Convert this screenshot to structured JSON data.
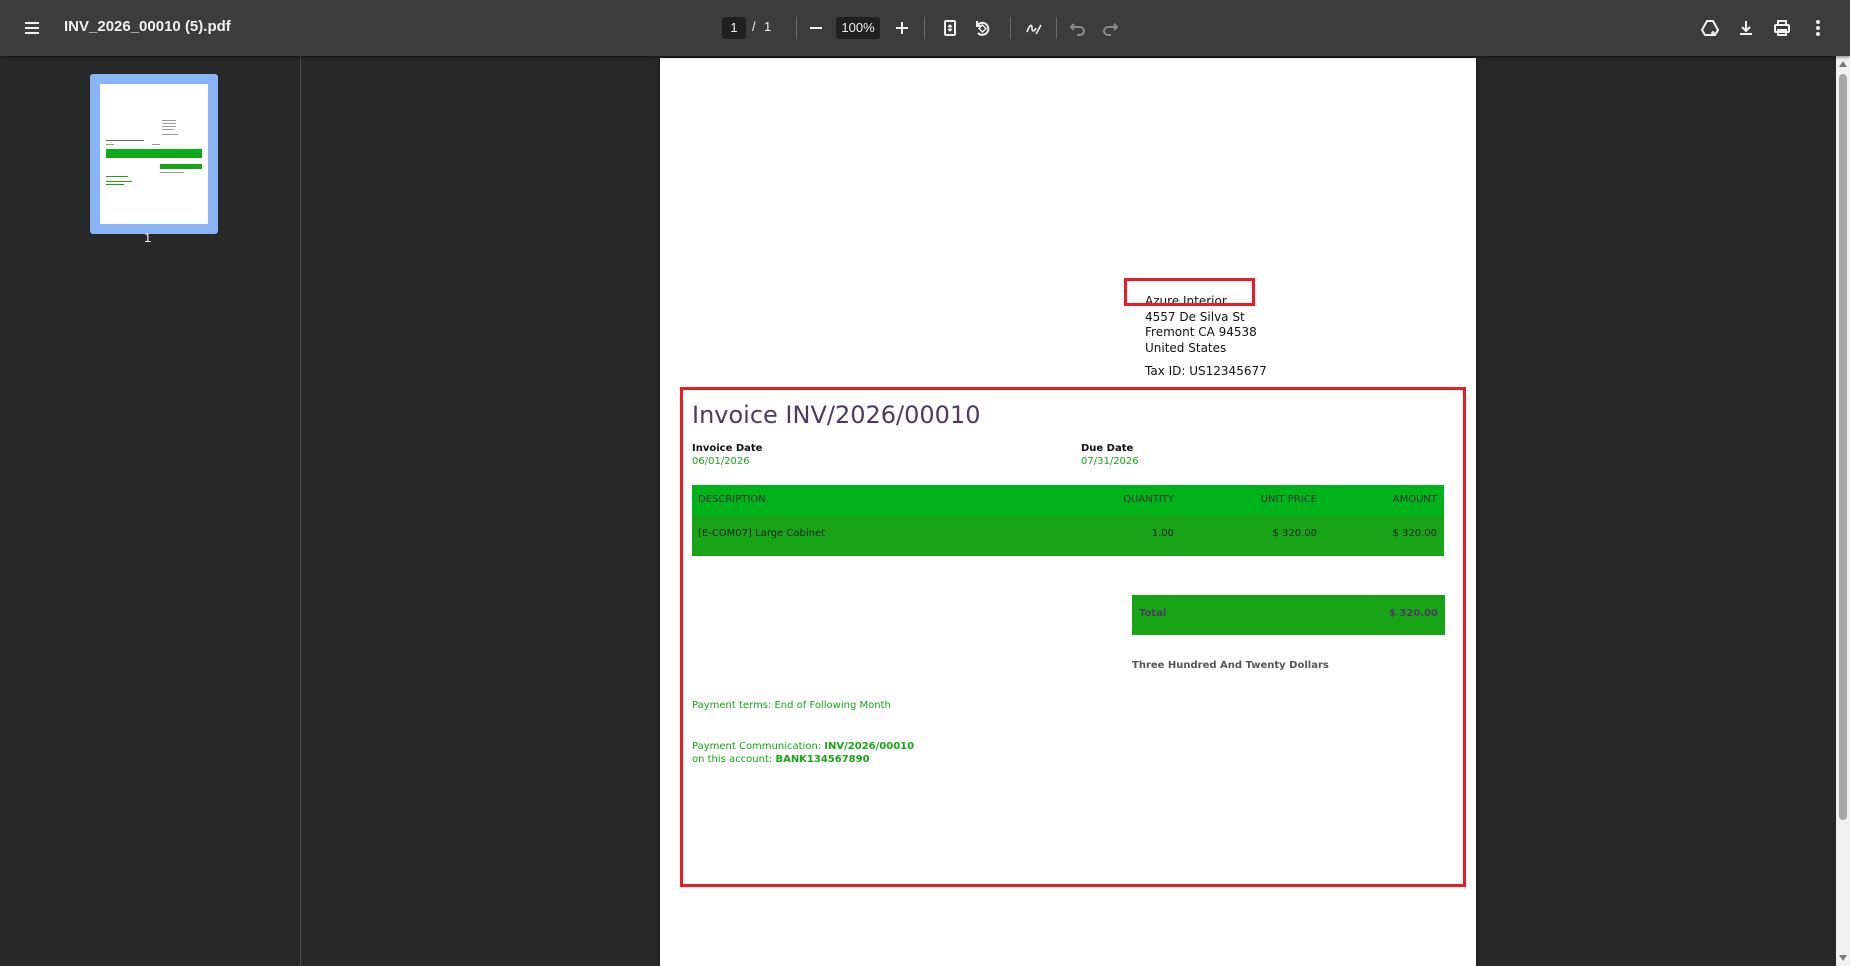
{
  "toolbar": {
    "title": "INV_2026_00010 (5).pdf",
    "current_page": "1",
    "page_separator": "/",
    "total_pages": "1",
    "zoom": "100%",
    "icons": [
      "menu-icon",
      "zoom-out-icon",
      "zoom-in-icon",
      "fit-page-icon",
      "rotate-icon",
      "annotate-icon",
      "undo-icon",
      "redo-icon",
      "drive-icon",
      "download-icon",
      "print-icon",
      "more-icon"
    ]
  },
  "sidebar": {
    "thumbnail_label": "1",
    "selected_border_color": "#8ab4f8"
  },
  "document": {
    "address": {
      "name": "Azure Interior",
      "street": "4557 De Silva St",
      "city": "Fremont CA 94538",
      "country": "United States",
      "tax_id": "Tax ID: US12345677"
    },
    "invoice_title": "Invoice INV/2026/00010",
    "invoice_date_label": "Invoice Date",
    "invoice_date": "06/01/2026",
    "due_date_label": "Due Date",
    "due_date": "07/31/2026",
    "table": {
      "headers": [
        "DESCRIPTION",
        "QUANTITY",
        "UNIT PRICE",
        "AMOUNT"
      ],
      "rows": [
        {
          "description": "[E-COM07] Large Cabinet",
          "quantity": "1.00",
          "unit_price": "$ 320.00",
          "amount": "$ 320.00"
        }
      ]
    },
    "total_label": "Total",
    "total_value": "$ 320.00",
    "amount_in_words": "Three Hundred And Twenty Dollars",
    "payment_terms": "Payment terms: End of Following Month",
    "payment_comm_label": "Payment Communication: ",
    "payment_comm_ref": "INV/2026/00010",
    "account_label": "on this account: ",
    "account_number": "BANK134567890",
    "accent_green": "#17a517",
    "header_green": "#00b31b",
    "title_color": "#4d3b5e",
    "highlight_color": "#ec1c24"
  }
}
